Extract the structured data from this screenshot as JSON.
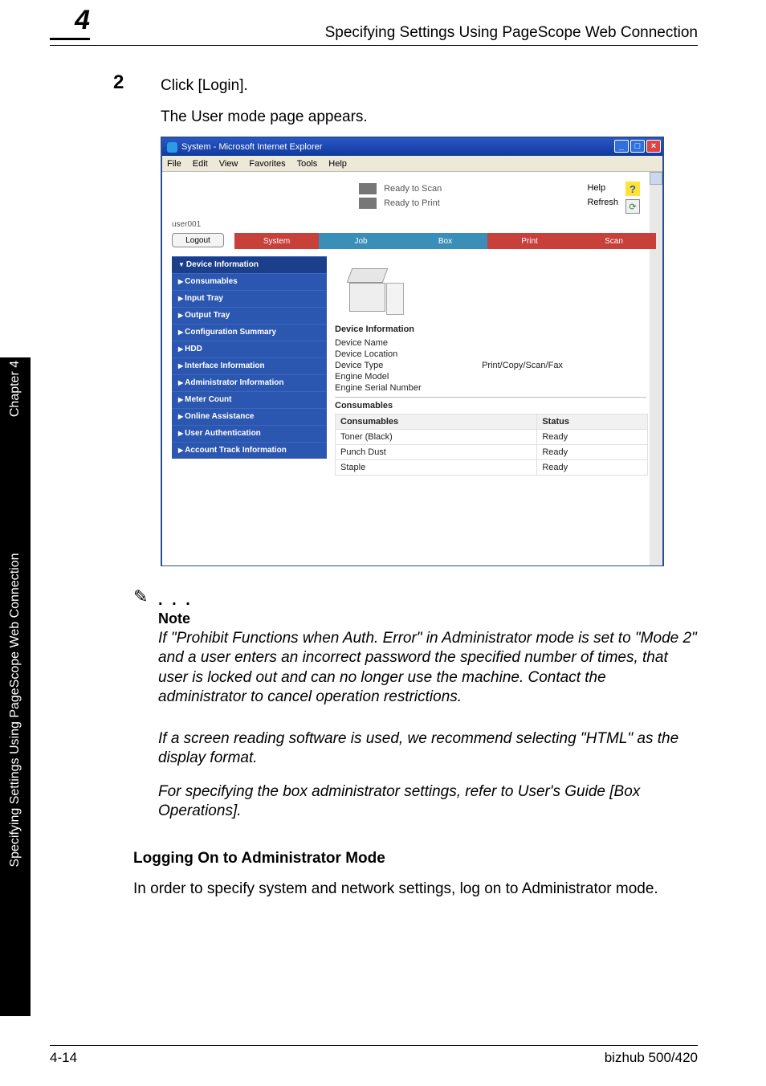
{
  "header": {
    "chapter_number": "4",
    "running_title": "Specifying Settings Using PageScope Web Connection"
  },
  "step": {
    "number": "2",
    "instruction": "Click [Login].",
    "result": "The User mode page appears."
  },
  "screenshot": {
    "window_title": "System - Microsoft Internet Explorer",
    "menubar": [
      "File",
      "Edit",
      "View",
      "Favorites",
      "Tools",
      "Help"
    ],
    "status": {
      "line1": "Ready to Scan",
      "line2": "Ready to Print"
    },
    "links": {
      "help": "Help",
      "refresh": "Refresh"
    },
    "user_label": "user001",
    "logout": "Logout",
    "tabs": {
      "system": "System",
      "job": "Job",
      "box": "Box",
      "print": "Print",
      "scan": "Scan"
    },
    "sidenav": [
      "Device Information",
      "Consumables",
      "Input Tray",
      "Output Tray",
      "Configuration Summary",
      "HDD",
      "Interface Information",
      "Administrator Information",
      "Meter Count",
      "Online Assistance",
      "User Authentication",
      "Account Track Information"
    ],
    "device_info": {
      "heading": "Device Information",
      "rows": [
        "Device Name",
        "Device Location",
        "Device Type",
        "Engine Model",
        "Engine Serial Number"
      ],
      "device_type_value": "Print/Copy/Scan/Fax"
    },
    "consumables": {
      "heading": "Consumables",
      "columns": [
        "Consumables",
        "Status"
      ],
      "rows": [
        {
          "name": "Toner (Black)",
          "status": "Ready"
        },
        {
          "name": "Punch Dust",
          "status": "Ready"
        },
        {
          "name": "Staple",
          "status": "Ready"
        }
      ]
    }
  },
  "note": {
    "label": "Note",
    "p1": "If \"Prohibit Functions when Auth. Error\" in Administrator mode is set to \"Mode 2\" and a user enters an incorrect password the specified number of times, that user is locked out and can no longer use the machine. Contact the administrator to cancel operation restrictions.",
    "p2": "If a screen reading software is used, we recommend selecting \"HTML\" as the display format.",
    "p3": "For specifying the box administrator settings, refer to User's Guide [Box Operations]."
  },
  "section": {
    "heading": "Logging On to Administrator Mode",
    "body": "In order to specify system and network settings, log on to Administrator mode."
  },
  "sidetab": {
    "chapter": "Chapter 4",
    "title": "Specifying Settings Using PageScope Web Connection"
  },
  "footer": {
    "left": "4-14",
    "right": "bizhub 500/420"
  }
}
